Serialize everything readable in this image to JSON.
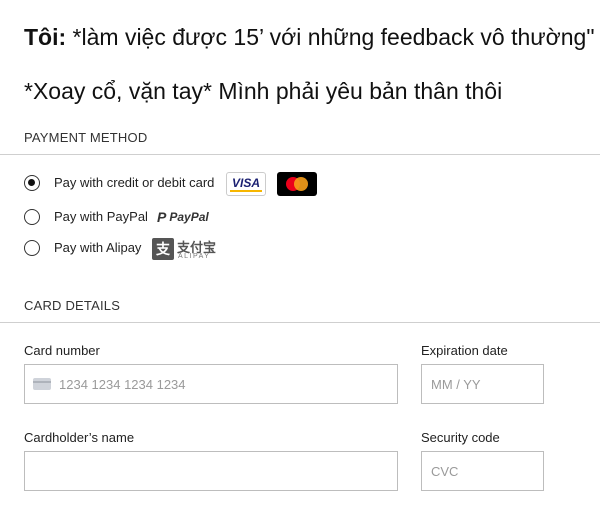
{
  "meme": {
    "line1_speaker": "Tôi:",
    "line1_text": "*làm việc được 15’ với những feedback vô thường\"",
    "line2_text": "*Xoay cổ, vặn tay* Mình phải yêu bản thân thôi"
  },
  "payment_method": {
    "section_title": "PAYMENT METHOD",
    "options": [
      {
        "label": "Pay with credit or debit card",
        "selected": true,
        "logos": [
          "VISA",
          "mastercard"
        ]
      },
      {
        "label": "Pay with PayPal",
        "selected": false,
        "logo_text": "PayPal",
        "logo_icon": "P"
      },
      {
        "label": "Pay with Alipay",
        "selected": false,
        "logo_icon": "支",
        "logo_cn": "支付宝",
        "logo_en": "ALIPAY"
      }
    ]
  },
  "card_details": {
    "section_title": "CARD DETAILS",
    "card_number": {
      "label": "Card number",
      "placeholder": "1234 1234 1234 1234"
    },
    "expiration": {
      "label": "Expiration date",
      "placeholder": "MM / YY"
    },
    "cardholder": {
      "label": "Cardholder’s name",
      "placeholder": ""
    },
    "security": {
      "label": "Security code",
      "placeholder": "CVC"
    }
  },
  "colors": {
    "visa_blue": "#1a1f71",
    "visa_gold": "#f7b600",
    "mc_red": "#eb001b",
    "mc_orange": "#f79e1b"
  }
}
